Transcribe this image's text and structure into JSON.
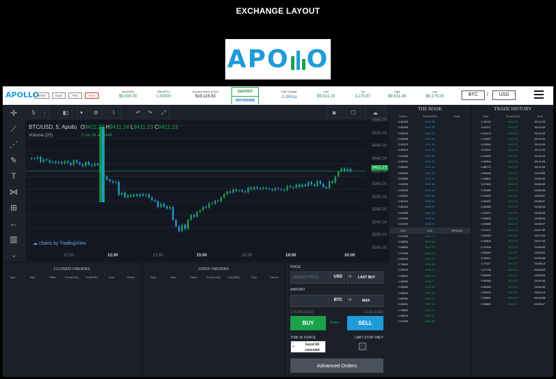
{
  "heading": "EXCHANGE LAYOUT",
  "logo": {
    "prefix": "APO",
    "suffix": "O",
    "bar_colors": [
      "#1aa34a",
      "#1f9bd8",
      "#1aa34a"
    ]
  },
  "topbar": {
    "mini_logo": "APOLLO",
    "buttons": [
      "RESET",
      "SAVE",
      "PRO",
      "NEW"
    ],
    "stats": [
      {
        "label": "Bal (USD)",
        "value": "$5,000.00",
        "color": "#1a8f3f"
      },
      {
        "label": "Bal (BTC)",
        "value": "1.50000",
        "color": "#1a8f3f"
      },
      {
        "label": "Account Value (USD)",
        "value": "$19,116.83",
        "color": "#222"
      },
      {
        "label": "24hr Change",
        "value": "-1.08%",
        "color": "#1f7fd0"
      },
      {
        "label": "Last",
        "value": "$9,411.23",
        "color": "#1a8f3f"
      },
      {
        "label": "Vol",
        "value": "3,170.87",
        "color": "#1a8f3f"
      },
      {
        "label": "High",
        "value": "$9,631.46",
        "color": "#1a8f3f"
      },
      {
        "label": "Low",
        "value": "$9,175.00",
        "color": "#1a8f3f"
      }
    ],
    "deposit": "DEPOSIT",
    "withdraw": "WITHDRAW",
    "base": "BTC",
    "sep": "/",
    "quote": "USD"
  },
  "chart": {
    "toolbar": {
      "interval": "5",
      "menu": "⋮"
    },
    "symbol": "BTC/USD, 5, Apollo",
    "ohlc": {
      "o_label": "O",
      "o": "9411.23",
      "h_label": "H",
      "h": "9411.24",
      "l_label": "L",
      "l": "9411.23",
      "c_label": "C",
      "c": "9411.23"
    },
    "volume_label": "Volume (20)",
    "volume_values": "8.34 28.483446",
    "last_price_tag": "9411.23",
    "price_ticks": [
      "9560.00",
      "9520.00",
      "9480.00",
      "9440.00",
      "9400.00",
      "9360.00",
      "9320.00",
      "9280.00",
      "9240.00",
      "9200.00",
      "9160.00"
    ],
    "time_ticks": [
      "10:30",
      "12:00",
      "13:30",
      "15:00",
      "16:30",
      "18:00",
      "20:00"
    ],
    "watermark": "charts by TradingView"
  },
  "chart_data": {
    "type": "candlestick",
    "ylim": [
      9160,
      9570
    ],
    "closes": [
      9452,
      9450,
      9455,
      9440,
      9448,
      9445,
      9438,
      9441,
      9436,
      9440,
      9435,
      9442,
      9437,
      9430,
      9445,
      9438,
      9432,
      9427,
      9440,
      9431,
      9428,
      9435,
      9430,
      9410,
      9395,
      9385,
      9380,
      9376,
      9378,
      9338,
      9345,
      9330,
      9337,
      9333,
      9339,
      9334,
      9340,
      9335,
      9339,
      9330,
      9322,
      9318,
      9300,
      9310,
      9302,
      9295,
      9300,
      9260,
      9240,
      9225,
      9245,
      9232,
      9260,
      9275,
      9270,
      9285,
      9290,
      9300,
      9298,
      9312,
      9310,
      9320,
      9318,
      9330,
      9340,
      9348,
      9345,
      9355,
      9350,
      9352,
      9348,
      9346,
      9360,
      9355,
      9362,
      9358,
      9356,
      9360,
      9357,
      9355,
      9352,
      9358,
      9356,
      9354,
      9352,
      9365,
      9362,
      9360,
      9370,
      9362,
      9370,
      9365,
      9378,
      9370,
      9365,
      9380,
      9372,
      9362,
      9358,
      9380,
      9375,
      9395,
      9410,
      9420,
      9412,
      9418,
      9411
    ]
  },
  "book": {
    "title": "THE BOOK",
    "headers": [
      "Orders",
      "Price(USD)",
      "Open"
    ],
    "asks": [
      [
        "0.00009",
        "9411.59"
      ],
      [
        "0.00165",
        "9411.38"
      ],
      [
        "0.00133",
        "9411.37"
      ],
      [
        "0.00155",
        "9411.36"
      ],
      [
        "0.00122",
        "9411.35"
      ],
      [
        "0.00409",
        "9411.34"
      ],
      [
        "0.00155",
        "9411.33"
      ],
      [
        "0.00154",
        "9411.32"
      ],
      [
        "0.05000",
        "9411.31"
      ],
      [
        "0.00154",
        "9411.30"
      ],
      [
        "3.00000",
        "9411.29"
      ],
      [
        "1.01230",
        "9410.00"
      ],
      [
        "0.00100",
        "9410.49"
      ],
      [
        "0.00244",
        "9406.03"
      ],
      [
        "0.00170",
        "9406.01"
      ],
      [
        "0.00144",
        "9406.00"
      ],
      [
        "0.00165",
        "9406.03"
      ],
      [
        "0.00165",
        "9406.02"
      ],
      [
        "0.01000",
        "9406.01"
      ]
    ],
    "spread": [
      "0.00",
      "0.01",
      "SPREAD"
    ],
    "bids": [
      [
        "0.07300",
        "9539.72"
      ],
      [
        "0.36800",
        "9543.55"
      ],
      [
        "0.54000",
        "9542.75"
      ],
      [
        "1.07000",
        "9525.13"
      ],
      [
        "0.02000",
        "9520.26"
      ],
      [
        "0.70400",
        "9525.80"
      ],
      [
        "0.20000",
        "9408.79"
      ],
      [
        "1.00000",
        "9406.79"
      ],
      [
        "1.00000",
        "9406.77"
      ],
      [
        "0.22084",
        "9406.00"
      ],
      [
        "1.00000",
        "9400.00"
      ],
      [
        "4.69250",
        "9398.70"
      ],
      [
        "0.00001",
        "9393.00"
      ],
      [
        "1.44600",
        "9392.72"
      ],
      [
        "0.34200",
        "9390.27"
      ],
      [
        "1.01200",
        "9380.88"
      ]
    ],
    "ask_color": "#1f9bd8",
    "bid_color": "#1aa34a"
  },
  "trades": {
    "title": "TRADE HISTORY",
    "headers": [
      "Size",
      "Price(USD)",
      "Time"
    ],
    "rows": [
      [
        "1.00143",
        "9412.23",
        "04:11:09"
      ],
      [
        "0.11471",
        "9412.23",
        "04:11:09"
      ],
      [
        "0.10473",
        "9412.23",
        "04:11:09"
      ],
      [
        "0.10257",
        "9412.23",
        "04:11:09"
      ],
      [
        "0.10000",
        "9412.23",
        "04:11:09"
      ],
      [
        "0.11001",
        "9412.23",
        "04:11:03"
      ],
      [
        "0.10000",
        "9412.23",
        "04:11:03"
      ],
      [
        "0.04064",
        "9412.23",
        "04:11:45"
      ],
      [
        "4.88772",
        "9411.24",
        "04:11:45"
      ],
      [
        "0.06428",
        "9412.23",
        "04:10:59"
      ],
      [
        "0.26804",
        "9411.24",
        "04:09:39"
      ],
      [
        "0.07364",
        "9411.24",
        "04:09:39"
      ],
      [
        "0.30380",
        "9412.23",
        "04:08:48"
      ],
      [
        "0.10000",
        "9411.24",
        "04:08:57"
      ],
      [
        "0.00287",
        "9412.23",
        "04:08:37"
      ],
      [
        "0.08260",
        "9412.23",
        "04:08:34"
      ],
      [
        "0.10670",
        "9412.23",
        "04:08:33"
      ],
      [
        "0.03800",
        "9411.24",
        "04:08:28"
      ],
      [
        "0.02680",
        "9411.24",
        "04:08:27"
      ],
      [
        "0.11471",
        "9411.24",
        "04:07:39"
      ],
      [
        "0.00318",
        "9412.23",
        "04:07:34"
      ],
      [
        "0.03800",
        "9411.24",
        "04:07:34"
      ],
      [
        "0.47200",
        "9411.97",
        "04:06:59"
      ],
      [
        "0.00262",
        "9411.97",
        "04:06:52"
      ],
      [
        "0.00021",
        "9411.97",
        "04:05:38"
      ],
      [
        "0.77117",
        "9411.97",
        "04:05:13"
      ],
      [
        "0.27776",
        "9411.97",
        "04:05:03"
      ],
      [
        "0.00090",
        "9411.97",
        "04:05:03"
      ],
      [
        "0.00083",
        "9411.97",
        "04:04:49"
      ],
      [
        "0.00460",
        "9411.01",
        "04:04:42"
      ],
      [
        "0.00429",
        "9411.01",
        "04:04:15"
      ],
      [
        "0.00662",
        "9411.97",
        "04:03:58"
      ],
      [
        "0.00800",
        "9411.97",
        "04:03:47"
      ]
    ]
  },
  "closed_orders": {
    "title": "CLOSED ORDERS",
    "headers": [
      "Type",
      "Size",
      "Filled",
      "Price(USD)",
      "Fee(DAE)",
      "Time",
      "Result"
    ]
  },
  "open_orders": {
    "title": "OPEN ORDERS",
    "headers": [
      "Type",
      "Size",
      "Filled",
      "Price(USD)",
      "Fee(DAE)",
      "Time",
      "Cancel"
    ]
  },
  "order_form": {
    "price_label": "PRICE",
    "price_placeholder": "MARKET PRICE",
    "price_currency": "USD",
    "last_buy": "LAST BUY",
    "amount_label": "AMOUNT",
    "amount_currency": "BTC",
    "max": "MAX",
    "total_label": "0 TOTAL(USD)",
    "fee_label": "0 FEE (DAE)",
    "buy": "BUY",
    "maker": "Maker",
    "sell": "SELL",
    "tif_label": "TIME IN FORCE",
    "tif_value": "Good till canceled",
    "limit_label": "LIMIT STOP ONLY",
    "advanced": "Advanced Orders"
  }
}
